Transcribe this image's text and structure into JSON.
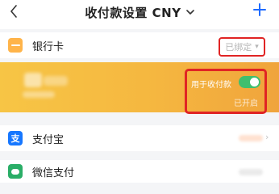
{
  "header": {
    "title": "收付款设置 CNY",
    "back_icon": "chevron-left-icon",
    "dropdown_icon": "chevron-down-icon",
    "add_icon": "plus-icon",
    "accent_color": "#1f6bff"
  },
  "bank_card": {
    "label": "银行卡",
    "icon": "bank-card-icon",
    "status": "已绑定",
    "card_gradient": [
      "#f7c545",
      "#f0a43c"
    ],
    "usage_label": "用于收付款",
    "usage_enabled": true,
    "usage_status": "已开启",
    "toggle_color": "#3fbf6e",
    "highlight_color": "#e02424"
  },
  "alipay": {
    "label": "支付宝",
    "icon": "alipay-icon",
    "icon_glyph": "支",
    "icon_color": "#1677ff"
  },
  "wechat": {
    "label": "微信支付",
    "icon": "wechat-pay-icon",
    "icon_color": "#2aae67"
  }
}
